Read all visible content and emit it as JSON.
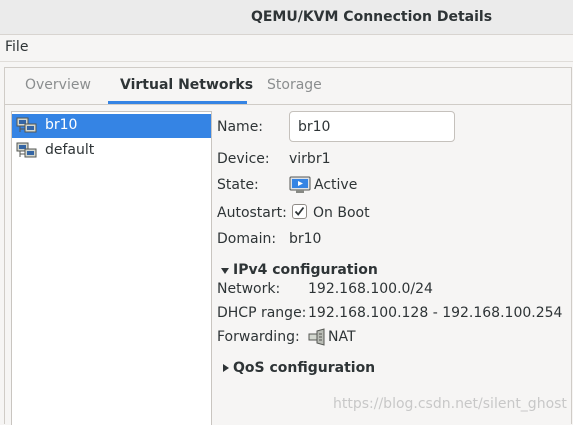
{
  "window": {
    "title": "QEMU/KVM Connection Details"
  },
  "menu": {
    "file": "File"
  },
  "tabs": [
    {
      "label": "Overview"
    },
    {
      "label": "Virtual Networks"
    },
    {
      "label": "Storage"
    }
  ],
  "networks": [
    {
      "name": "br10",
      "selected": true
    },
    {
      "name": "default",
      "selected": false
    }
  ],
  "details": {
    "name_label": "Name:",
    "name_value": "br10",
    "device_label": "Device:",
    "device_value": "virbr1",
    "state_label": "State:",
    "state_value": "Active",
    "autostart_label": "Autostart:",
    "autostart_value": "On Boot",
    "autostart_checked": true,
    "domain_label": "Domain:",
    "domain_value": "br10"
  },
  "ipv4": {
    "header": "IPv4 configuration",
    "expanded": true,
    "network_label": "Network:",
    "network_value": "192.168.100.0/24",
    "dhcp_label": "DHCP range:",
    "dhcp_value": "192.168.100.128 - 192.168.100.254",
    "forwarding_label": "Forwarding:",
    "forwarding_value": "NAT"
  },
  "qos": {
    "header": "QoS configuration",
    "expanded": false
  },
  "watermark": "https://blog.csdn.net/silent_ghost",
  "colors": {
    "accent": "#3584e4",
    "selected_text": "#ffffff"
  }
}
